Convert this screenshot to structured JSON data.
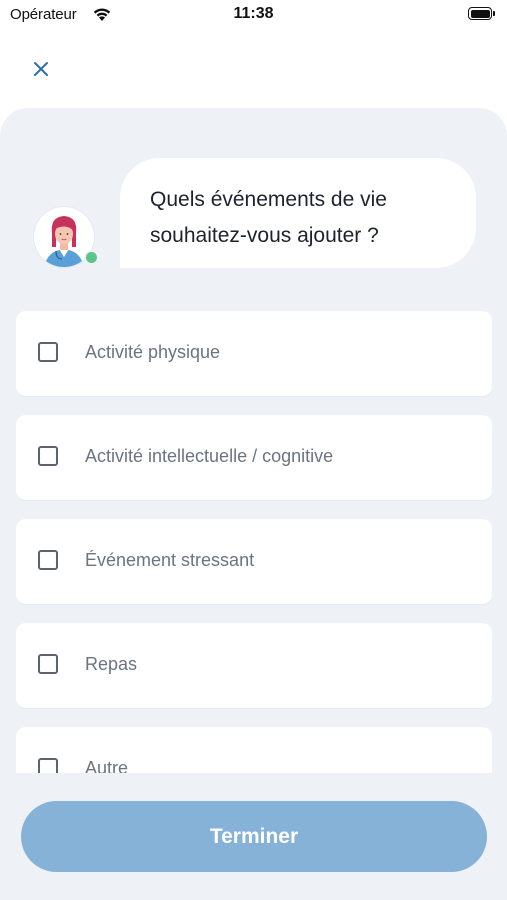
{
  "status_bar": {
    "carrier": "Opérateur",
    "time": "11:38"
  },
  "header": {
    "close_icon": "close-icon"
  },
  "assistant": {
    "avatar": "nurse-avatar",
    "question": "Quels événements de vie souhaitez-vous ajouter ?"
  },
  "options": [
    {
      "label": "Activité physique",
      "checked": false
    },
    {
      "label": "Activité intellectuelle / cognitive",
      "checked": false
    },
    {
      "label": "Événement stressant",
      "checked": false
    },
    {
      "label": "Repas",
      "checked": false
    },
    {
      "label": "Autre",
      "checked": false
    }
  ],
  "footer": {
    "finish_label": "Terminer"
  },
  "colors": {
    "accent": "#2f6fa3",
    "button_disabled": "#87b2d8",
    "panel_bg": "#eef2f7",
    "status_online": "#5cc38a"
  }
}
